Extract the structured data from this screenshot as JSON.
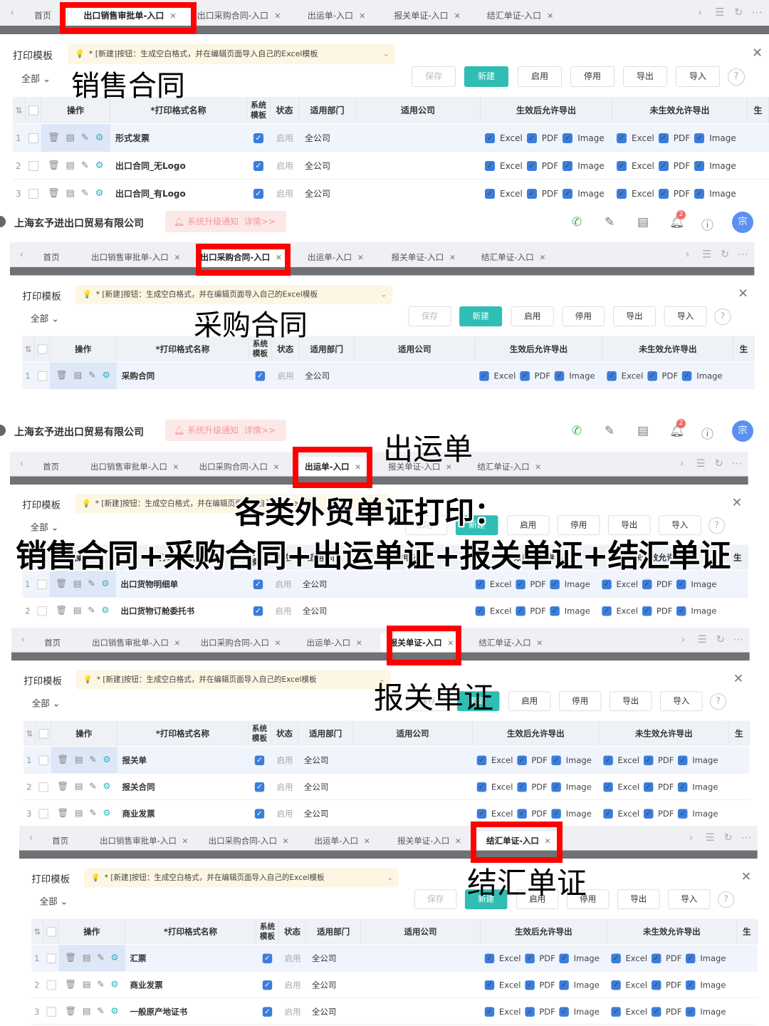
{
  "tabs": [
    "首页",
    "出口销售审批单-入口",
    "出口采购合同-入口",
    "出运单-入口",
    "报关单证-入口",
    "结汇单证-入口"
  ],
  "template": {
    "title": "打印模板",
    "notice": "* [新建]按钮：生成空白格式，并在编辑页面导入自己的Excel模板",
    "filter": "全部",
    "buttons": [
      "保存",
      "新建",
      "启用",
      "停用",
      "导出",
      "导入"
    ],
    "help": "?",
    "columns": [
      "操作",
      "*打印格式名称",
      "系统模板",
      "状态",
      "适用部门",
      "适用公司",
      "生效后允许导出",
      "未生效允许导出",
      "生"
    ],
    "export_options": [
      "Excel",
      "PDF",
      "Image"
    ]
  },
  "company_bar": {
    "name": "上海玄予进出口贸易有限公司",
    "upgrade_notice": "系统升级通知",
    "details_link": "详情>>",
    "notification_count": "2",
    "avatar": "宗"
  },
  "panels": [
    {
      "active_tab": 1,
      "label": "销售合同",
      "rows": [
        {
          "no": "1",
          "name": "形式发票",
          "status": "启用",
          "dept": "全公司"
        },
        {
          "no": "2",
          "name": "出口合同_无Logo",
          "status": "启用",
          "dept": "全公司"
        },
        {
          "no": "3",
          "name": "出口合同_有Logo",
          "status": "启用",
          "dept": "全公司"
        }
      ]
    },
    {
      "active_tab": 2,
      "label": "采购合同",
      "rows": [
        {
          "no": "1",
          "name": "采购合同",
          "status": "启用",
          "dept": "全公司"
        }
      ]
    },
    {
      "active_tab": 3,
      "label": "出运单",
      "rows": [
        {
          "no": "1",
          "name": "出口货物明细单",
          "status": "启用",
          "dept": "全公司"
        },
        {
          "no": "2",
          "name": "出口货物订舱委托书",
          "status": "启用",
          "dept": "全公司"
        }
      ]
    },
    {
      "active_tab": 4,
      "label": "报关单证",
      "rows": [
        {
          "no": "1",
          "name": "报关单",
          "status": "启用",
          "dept": "全公司"
        },
        {
          "no": "2",
          "name": "报关合同",
          "status": "启用",
          "dept": "全公司"
        },
        {
          "no": "3",
          "name": "商业发票",
          "status": "启用",
          "dept": "全公司"
        }
      ]
    },
    {
      "active_tab": 5,
      "label": "结汇单证",
      "rows": [
        {
          "no": "1",
          "name": "汇票",
          "status": "启用",
          "dept": "全公司"
        },
        {
          "no": "2",
          "name": "商业发票",
          "status": "启用",
          "dept": "全公司"
        },
        {
          "no": "3",
          "name": "一般原产地证书",
          "status": "启用",
          "dept": "全公司"
        }
      ]
    }
  ],
  "headline": {
    "line1": "各类外贸单证打印：",
    "line2": "销售合同+采购合同+出运单证+报关单证+结汇单证"
  },
  "colors": {
    "primary": "#2fbdb4",
    "checkbox": "#3b7ddd",
    "highlight": "#ff0000"
  }
}
